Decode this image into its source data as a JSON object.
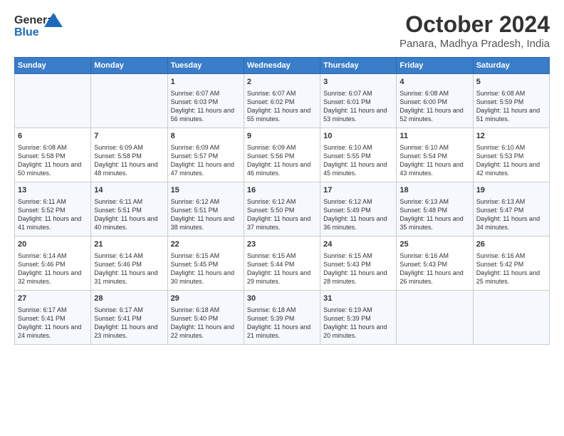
{
  "logo": {
    "line1": "General",
    "line2": "Blue"
  },
  "title": "October 2024",
  "subtitle": "Panara, Madhya Pradesh, India",
  "days_of_week": [
    "Sunday",
    "Monday",
    "Tuesday",
    "Wednesday",
    "Thursday",
    "Friday",
    "Saturday"
  ],
  "weeks": [
    [
      {
        "day": "",
        "content": ""
      },
      {
        "day": "",
        "content": ""
      },
      {
        "day": "1",
        "content": "Sunrise: 6:07 AM\nSunset: 6:03 PM\nDaylight: 11 hours and 56 minutes."
      },
      {
        "day": "2",
        "content": "Sunrise: 6:07 AM\nSunset: 6:02 PM\nDaylight: 11 hours and 55 minutes."
      },
      {
        "day": "3",
        "content": "Sunrise: 6:07 AM\nSunset: 6:01 PM\nDaylight: 11 hours and 53 minutes."
      },
      {
        "day": "4",
        "content": "Sunrise: 6:08 AM\nSunset: 6:00 PM\nDaylight: 11 hours and 52 minutes."
      },
      {
        "day": "5",
        "content": "Sunrise: 6:08 AM\nSunset: 5:59 PM\nDaylight: 11 hours and 51 minutes."
      }
    ],
    [
      {
        "day": "6",
        "content": "Sunrise: 6:08 AM\nSunset: 5:58 PM\nDaylight: 11 hours and 50 minutes."
      },
      {
        "day": "7",
        "content": "Sunrise: 6:09 AM\nSunset: 5:58 PM\nDaylight: 11 hours and 48 minutes."
      },
      {
        "day": "8",
        "content": "Sunrise: 6:09 AM\nSunset: 5:57 PM\nDaylight: 11 hours and 47 minutes."
      },
      {
        "day": "9",
        "content": "Sunrise: 6:09 AM\nSunset: 5:56 PM\nDaylight: 11 hours and 46 minutes."
      },
      {
        "day": "10",
        "content": "Sunrise: 6:10 AM\nSunset: 5:55 PM\nDaylight: 11 hours and 45 minutes."
      },
      {
        "day": "11",
        "content": "Sunrise: 6:10 AM\nSunset: 5:54 PM\nDaylight: 11 hours and 43 minutes."
      },
      {
        "day": "12",
        "content": "Sunrise: 6:10 AM\nSunset: 5:53 PM\nDaylight: 11 hours and 42 minutes."
      }
    ],
    [
      {
        "day": "13",
        "content": "Sunrise: 6:11 AM\nSunset: 5:52 PM\nDaylight: 11 hours and 41 minutes."
      },
      {
        "day": "14",
        "content": "Sunrise: 6:11 AM\nSunset: 5:51 PM\nDaylight: 11 hours and 40 minutes."
      },
      {
        "day": "15",
        "content": "Sunrise: 6:12 AM\nSunset: 5:51 PM\nDaylight: 11 hours and 38 minutes."
      },
      {
        "day": "16",
        "content": "Sunrise: 6:12 AM\nSunset: 5:50 PM\nDaylight: 11 hours and 37 minutes."
      },
      {
        "day": "17",
        "content": "Sunrise: 6:12 AM\nSunset: 5:49 PM\nDaylight: 11 hours and 36 minutes."
      },
      {
        "day": "18",
        "content": "Sunrise: 6:13 AM\nSunset: 5:48 PM\nDaylight: 11 hours and 35 minutes."
      },
      {
        "day": "19",
        "content": "Sunrise: 6:13 AM\nSunset: 5:47 PM\nDaylight: 11 hours and 34 minutes."
      }
    ],
    [
      {
        "day": "20",
        "content": "Sunrise: 6:14 AM\nSunset: 5:46 PM\nDaylight: 11 hours and 32 minutes."
      },
      {
        "day": "21",
        "content": "Sunrise: 6:14 AM\nSunset: 5:46 PM\nDaylight: 11 hours and 31 minutes."
      },
      {
        "day": "22",
        "content": "Sunrise: 6:15 AM\nSunset: 5:45 PM\nDaylight: 11 hours and 30 minutes."
      },
      {
        "day": "23",
        "content": "Sunrise: 6:15 AM\nSunset: 5:44 PM\nDaylight: 11 hours and 29 minutes."
      },
      {
        "day": "24",
        "content": "Sunrise: 6:15 AM\nSunset: 5:43 PM\nDaylight: 11 hours and 28 minutes."
      },
      {
        "day": "25",
        "content": "Sunrise: 6:16 AM\nSunset: 5:43 PM\nDaylight: 11 hours and 26 minutes."
      },
      {
        "day": "26",
        "content": "Sunrise: 6:16 AM\nSunset: 5:42 PM\nDaylight: 11 hours and 25 minutes."
      }
    ],
    [
      {
        "day": "27",
        "content": "Sunrise: 6:17 AM\nSunset: 5:41 PM\nDaylight: 11 hours and 24 minutes."
      },
      {
        "day": "28",
        "content": "Sunrise: 6:17 AM\nSunset: 5:41 PM\nDaylight: 11 hours and 23 minutes."
      },
      {
        "day": "29",
        "content": "Sunrise: 6:18 AM\nSunset: 5:40 PM\nDaylight: 11 hours and 22 minutes."
      },
      {
        "day": "30",
        "content": "Sunrise: 6:18 AM\nSunset: 5:39 PM\nDaylight: 11 hours and 21 minutes."
      },
      {
        "day": "31",
        "content": "Sunrise: 6:19 AM\nSunset: 5:39 PM\nDaylight: 11 hours and 20 minutes."
      },
      {
        "day": "",
        "content": ""
      },
      {
        "day": "",
        "content": ""
      }
    ]
  ],
  "accent_color": "#3a7dc9"
}
